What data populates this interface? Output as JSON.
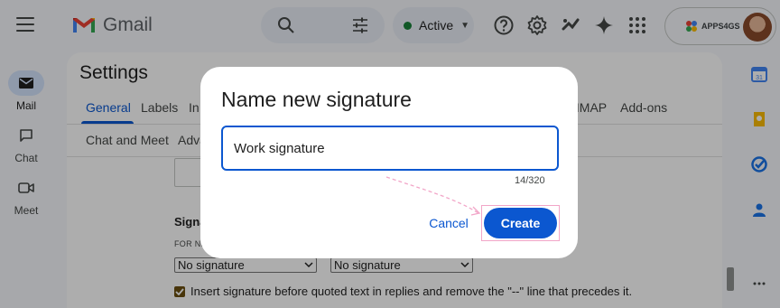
{
  "app": {
    "name": "Gmail"
  },
  "header": {
    "status": {
      "label": "Active",
      "color": "#188038"
    },
    "org_label": "APPS4GS"
  },
  "rail": {
    "items": [
      {
        "label": "Mail",
        "icon": "mail-icon",
        "active": true
      },
      {
        "label": "Chat",
        "icon": "chat-icon",
        "active": false
      },
      {
        "label": "Meet",
        "icon": "video-icon",
        "active": false
      }
    ]
  },
  "settings": {
    "title": "Settings",
    "tabs": {
      "general": "General",
      "labels": "Labels",
      "inbox": "In",
      "pop": "/IMAP",
      "addons": "Add-ons",
      "chat_meet": "Chat and Meet",
      "advanced": "Adva"
    },
    "signature_section": "Signa",
    "defaults_sub": "FOR NE",
    "new_email_select": "No signature",
    "reply_select": "No signature",
    "insert_before_quoted": "Insert signature before quoted text in replies and remove the \"--\" line that precedes it."
  },
  "dialog": {
    "title": "Name new signature",
    "input_value": "Work signature",
    "char_count": "14/320",
    "cancel_label": "Cancel",
    "create_label": "Create"
  },
  "colors": {
    "accent": "#0b57d0",
    "highlight": "#f2a6c8"
  }
}
